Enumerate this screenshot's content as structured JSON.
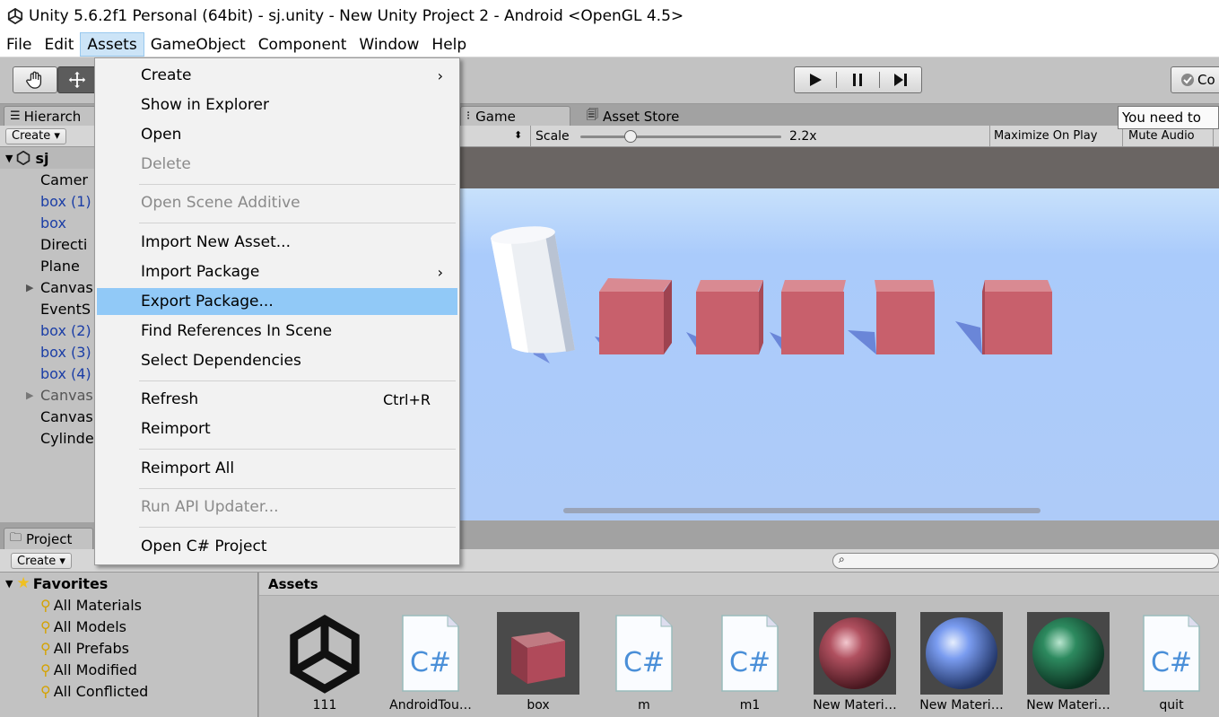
{
  "window": {
    "title": "Unity 5.6.2f1 Personal (64bit) - sj.unity - New Unity Project 2 - Android <OpenGL 4.5>"
  },
  "menubar": {
    "items": [
      "File",
      "Edit",
      "Assets",
      "GameObject",
      "Component",
      "Window",
      "Help"
    ],
    "active": "Assets"
  },
  "toolbar": {
    "collab_label": "Co"
  },
  "hierarchy": {
    "tab_label": "Hierarch",
    "create_label": "Create",
    "scene_name": "sj",
    "items": [
      {
        "label": "Camer"
      },
      {
        "label": "box (1)"
      },
      {
        "label": "box"
      },
      {
        "label": "Directi"
      },
      {
        "label": "Plane"
      },
      {
        "label": "Canvas"
      },
      {
        "label": "EventS"
      },
      {
        "label": "box (2)"
      },
      {
        "label": "box (3)"
      },
      {
        "label": "box (4)"
      },
      {
        "label": "Canvas"
      },
      {
        "label": "Canvas"
      },
      {
        "label": "Cylinde"
      }
    ]
  },
  "game": {
    "tab_game": "Game",
    "tab_store": "Asset Store",
    "scale_label": "Scale",
    "scale_value": "2.2x",
    "scale_fraction": 0.25,
    "maximize_label": "Maximize On Play",
    "mute_label": "Mute Audio",
    "tooltip": "You need to"
  },
  "assets_menu": {
    "items": [
      {
        "label": "Create",
        "submenu": true
      },
      {
        "label": "Show in Explorer"
      },
      {
        "label": "Open"
      },
      {
        "label": "Delete",
        "disabled": true
      },
      {
        "label": "Open Scene Additive",
        "disabled": true
      },
      {
        "label": "Import New Asset..."
      },
      {
        "label": "Import Package",
        "submenu": true
      },
      {
        "label": "Export Package...",
        "highlighted": true
      },
      {
        "label": "Find References In Scene"
      },
      {
        "label": "Select Dependencies"
      },
      {
        "label": "Refresh",
        "shortcut": "Ctrl+R"
      },
      {
        "label": "Reimport"
      },
      {
        "label": "Reimport All"
      },
      {
        "label": "Run API Updater...",
        "disabled": true
      },
      {
        "label": "Open C# Project"
      }
    ]
  },
  "project": {
    "tab_label": "Project",
    "create_label": "Create",
    "favorites_label": "Favorites",
    "favorites": [
      "All Materials",
      "All Models",
      "All Prefabs",
      "All Modified",
      "All Conflicted"
    ],
    "assets_header": "Assets",
    "assets": [
      {
        "label": "111",
        "icon": "unity-logo-icon"
      },
      {
        "label": "AndroidTou…",
        "icon": "csharp-script-icon"
      },
      {
        "label": "box",
        "icon": "cube-prefab-icon"
      },
      {
        "label": "m",
        "icon": "csharp-script-icon"
      },
      {
        "label": "m1",
        "icon": "csharp-script-icon"
      },
      {
        "label": "New Materi…",
        "icon": "material-sphere-icon",
        "color": "#b0505f"
      },
      {
        "label": "New Materi…",
        "icon": "material-sphere-icon",
        "color": "#7a9cf0"
      },
      {
        "label": "New Materi…",
        "icon": "material-sphere-icon",
        "color": "#2d8a5f"
      },
      {
        "label": "quit",
        "icon": "csharp-script-icon"
      }
    ]
  },
  "colors": {
    "menu_highlight": "#91c9f7",
    "box_red": "#c8606c",
    "sky": "#aecbf8"
  }
}
